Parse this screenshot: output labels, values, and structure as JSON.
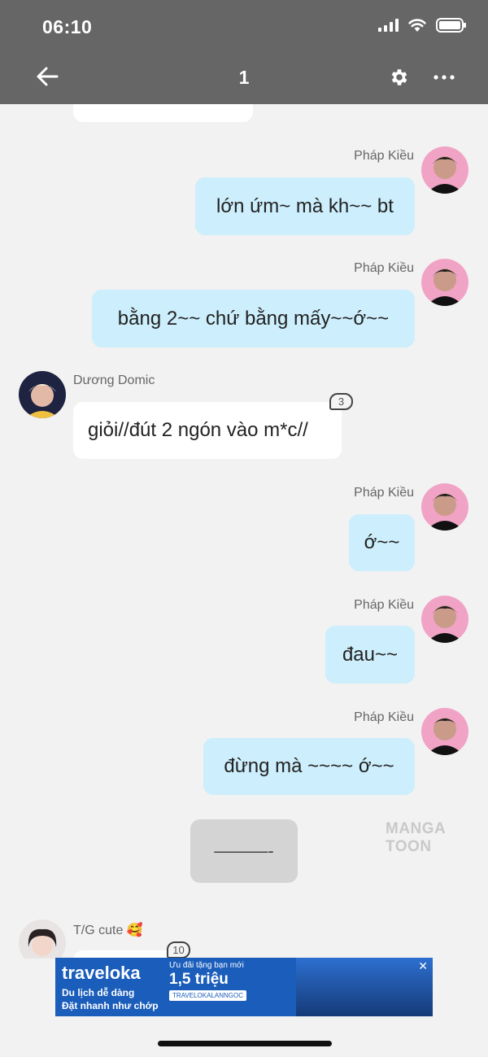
{
  "status_bar": {
    "time": "06:10"
  },
  "header": {
    "title": "1"
  },
  "messages": [
    {
      "sender": "Pháp Kiều",
      "text": "lớn ứm~ mà kh~~ bt"
    },
    {
      "sender": "Pháp Kiều",
      "text": "bằng 2~~ chứ bằng mấy~~ớ~~"
    },
    {
      "sender": "Dương Domic",
      "text": "giỏi//đút 2 ngón vào m*c//",
      "badge": "3"
    },
    {
      "sender": "Pháp Kiều",
      "text": "ớ~~"
    },
    {
      "sender": "Pháp Kiều",
      "text": "đau~~"
    },
    {
      "sender": "Pháp Kiều",
      "text": "đừng mà ~~~~ ớ~~"
    },
    {
      "system": "———-"
    },
    {
      "sender": "T/G cute 🥰",
      "badge": "10"
    }
  ],
  "watermark": "MANGA TOON",
  "ad": {
    "brand": "traveloka",
    "line1": "Du lịch dễ dàng",
    "line2": "Đặt nhanh như chớp",
    "promo_small": "Ưu đãi tặng bạn mới",
    "promo_big": "1,5 triệu",
    "code": "TRAVELOKALANNGOC"
  },
  "colors": {
    "my_bubble": "#cdeefc",
    "their_bubble": "#ffffff",
    "header_bg": "#666666"
  }
}
